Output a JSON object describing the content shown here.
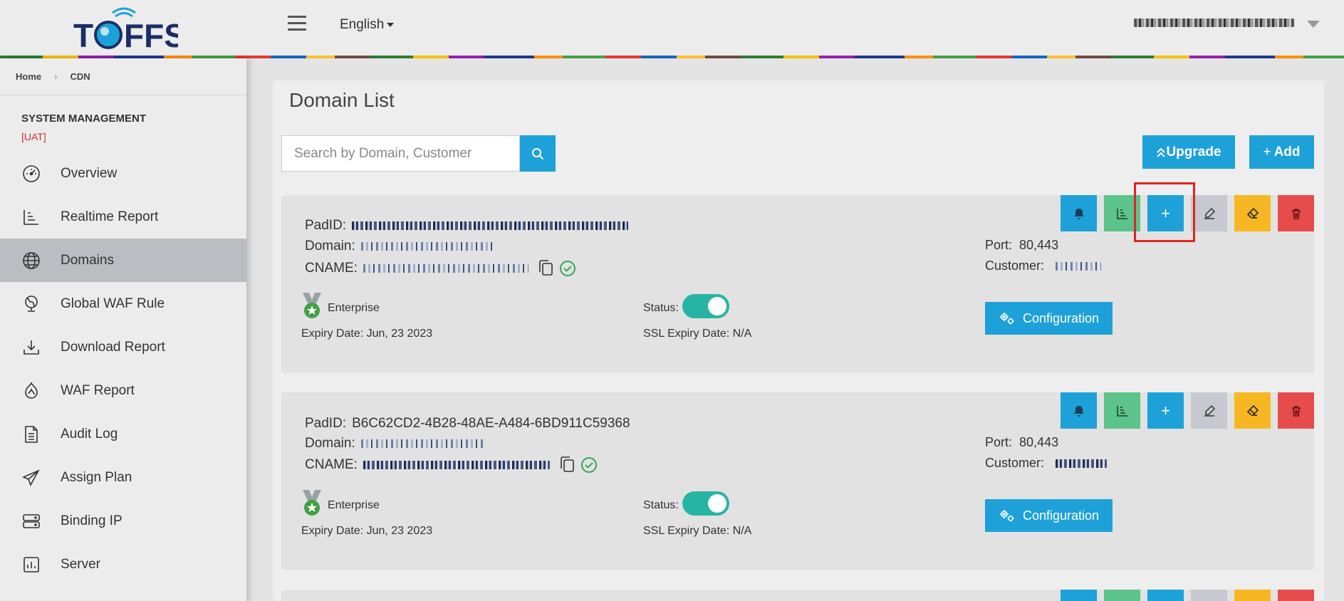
{
  "header": {
    "logo_text": "TOFFS",
    "language": "English"
  },
  "breadcrumb": {
    "home": "Home",
    "current": "CDN"
  },
  "sidebar": {
    "section_title": "SYSTEM MANAGEMENT",
    "env_badge": "[UAT]",
    "items": [
      {
        "label": "Overview",
        "icon": "gauge-icon"
      },
      {
        "label": "Realtime Report",
        "icon": "bar-chart-icon"
      },
      {
        "label": "Domains",
        "icon": "globe-icon",
        "active": true
      },
      {
        "label": "Global WAF Rule",
        "icon": "globe-stand-icon"
      },
      {
        "label": "Download Report",
        "icon": "download-icon"
      },
      {
        "label": "WAF Report",
        "icon": "shield-flame-icon"
      },
      {
        "label": "Audit Log",
        "icon": "document-icon"
      },
      {
        "label": "Assign Plan",
        "icon": "paper-plane-icon"
      },
      {
        "label": "Binding IP",
        "icon": "server-rack-icon"
      },
      {
        "label": "Server",
        "icon": "server-chart-icon"
      }
    ]
  },
  "main": {
    "title": "Domain List",
    "search_placeholder": "Search by Domain, Customer",
    "upgrade_label": "Upgrade",
    "add_label": "Add",
    "domains": [
      {
        "padid_label": "PadID:",
        "padid": "",
        "domain_label": "Domain:",
        "cname_label": "CNAME:",
        "plan": "Enterprise",
        "expiry": "Expiry Date: Jun, 23 2023",
        "status_label": "Status:",
        "ssl_expiry": "SSL Expiry Date: N/A",
        "port_label": "Port:",
        "port": "80,443",
        "customer_label": "Customer:",
        "config_label": "Configuration"
      },
      {
        "padid_label": "PadID:",
        "padid": "B6C62CD2-4B28-48AE-A484-6BD911C59368",
        "domain_label": "Domain:",
        "cname_label": "CNAME:",
        "plan": "Enterprise",
        "expiry": "Expiry Date: Jun, 23 2023",
        "status_label": "Status:",
        "ssl_expiry": "SSL Expiry Date: N/A",
        "port_label": "Port:",
        "port": "80,443",
        "customer_label": "Customer:",
        "config_label": "Configuration"
      }
    ]
  }
}
